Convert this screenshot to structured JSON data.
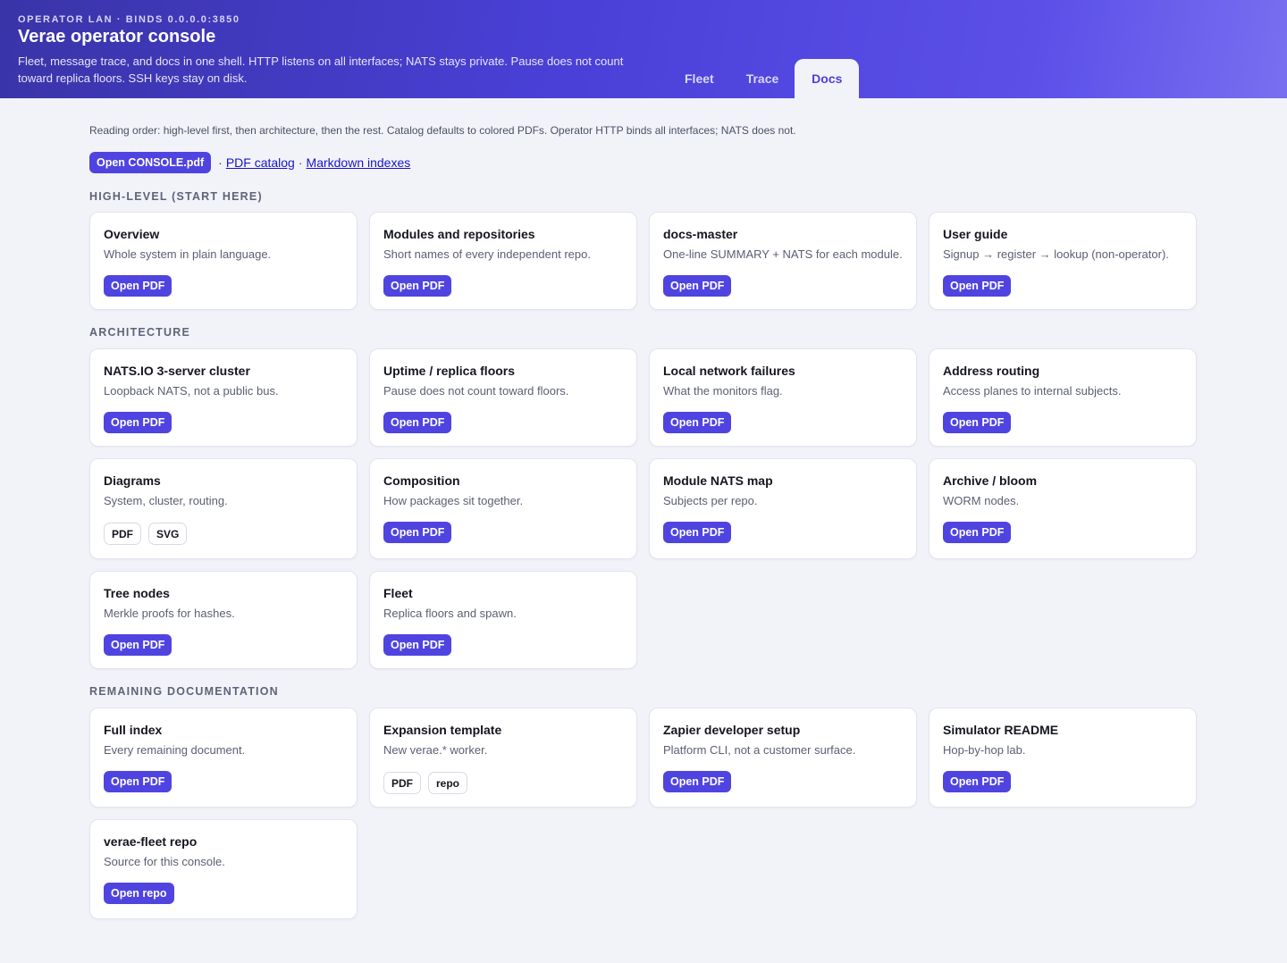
{
  "header": {
    "eyebrow": "OPERATOR LAN · BINDS 0.0.0.0:3850",
    "title": "Verae operator console",
    "subtitle": "Fleet, message trace, and docs in one shell. HTTP listens on all interfaces; NATS stays private. Pause does not count toward replica floors. SSH keys stay on disk.",
    "tabs": [
      {
        "label": "Fleet",
        "active": false
      },
      {
        "label": "Trace",
        "active": false
      },
      {
        "label": "Docs",
        "active": true
      }
    ]
  },
  "main": {
    "note": "Reading order: high-level first, then architecture, then the rest. Catalog defaults to colored PDFs. Operator HTTP binds all interfaces; NATS does not.",
    "primary_button": "Open CONSOLE.pdf",
    "separator": "·",
    "link_catalog": "PDF catalog",
    "link_markdown": "Markdown indexes",
    "sections": [
      {
        "title": "HIGH-LEVEL (START HERE)",
        "cards": [
          {
            "title": "Overview",
            "desc": "Whole system in plain language.",
            "button": "Open PDF"
          },
          {
            "title": "Modules and repositories",
            "desc": "Short names of every independent repo.",
            "button": "Open PDF"
          },
          {
            "title": "docs-master",
            "desc": "One-line SUMMARY + NATS for each module.",
            "button": "Open PDF"
          },
          {
            "title": "User guide",
            "desc": "Signup → register → lookup (non-operator).",
            "button": "Open PDF"
          }
        ]
      },
      {
        "title": "ARCHITECTURE",
        "cards": [
          {
            "title": "NATS.IO 3-server cluster",
            "desc": "Loopback NATS, not a public bus.",
            "button": "Open PDF"
          },
          {
            "title": "Uptime / replica floors",
            "desc": "Pause does not count toward floors.",
            "button": "Open PDF"
          },
          {
            "title": "Local network failures",
            "desc": "What the monitors flag.",
            "button": "Open PDF"
          },
          {
            "title": "Address routing",
            "desc": "Access planes to internal subjects.",
            "button": "Open PDF"
          },
          {
            "title": "Diagrams",
            "desc": "System, cluster, routing.",
            "chips": [
              "PDF",
              "SVG"
            ]
          },
          {
            "title": "Composition",
            "desc": "How packages sit together.",
            "button": "Open PDF"
          },
          {
            "title": "Module NATS map",
            "desc": "Subjects per repo.",
            "button": "Open PDF"
          },
          {
            "title": "Archive / bloom",
            "desc": "WORM nodes.",
            "button": "Open PDF"
          },
          {
            "title": "Tree nodes",
            "desc": "Merkle proofs for hashes.",
            "button": "Open PDF"
          },
          {
            "title": "Fleet",
            "desc": "Replica floors and spawn.",
            "button": "Open PDF"
          }
        ]
      },
      {
        "title": "REMAINING DOCUMENTATION",
        "cards": [
          {
            "title": "Full index",
            "desc": "Every remaining document.",
            "button": "Open PDF"
          },
          {
            "title": "Expansion template",
            "desc": "New verae.* worker.",
            "chips": [
              "PDF",
              "repo"
            ]
          },
          {
            "title": "Zapier developer setup",
            "desc": "Platform CLI, not a customer surface.",
            "button": "Open PDF"
          },
          {
            "title": "Simulator README",
            "desc": "Hop-by-hop lab.",
            "button": "Open PDF"
          },
          {
            "title": "verae-fleet repo",
            "desc": "Source for this console.",
            "button": "Open repo"
          }
        ]
      }
    ]
  },
  "colors": {
    "accent": "#4f44e0",
    "header_start": "#3a34a8",
    "header_end": "#786ff0",
    "page_bg": "#f2f3f9"
  }
}
